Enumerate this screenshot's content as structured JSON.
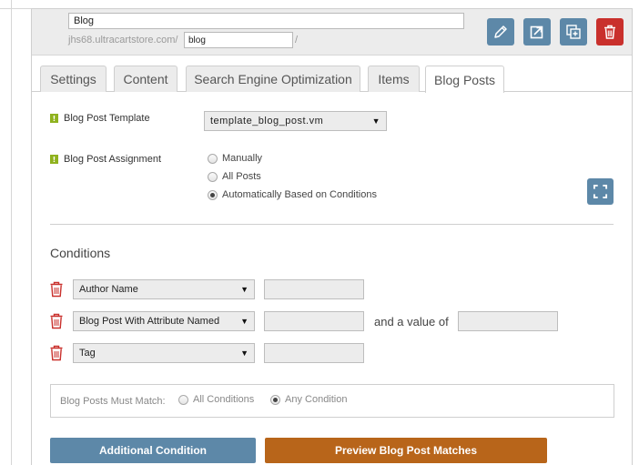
{
  "header": {
    "title_value": "Blog",
    "url_prefix": "jhs68.ultracartstore.com/",
    "slug_value": "blog",
    "url_suffix": "/",
    "buttons": [
      {
        "icon": "pencil-icon"
      },
      {
        "icon": "external-link-icon"
      },
      {
        "icon": "copy-icon"
      },
      {
        "icon": "trash-icon"
      }
    ],
    "colors": {
      "action_blue": "#5d88a8",
      "delete_red": "#c9302c"
    }
  },
  "tabs": [
    {
      "label": "Settings",
      "active": false
    },
    {
      "label": "Content",
      "active": false
    },
    {
      "label": "Search Engine Optimization",
      "active": false
    },
    {
      "label": "Items",
      "active": false
    },
    {
      "label": "Blog Posts",
      "active": true
    }
  ],
  "template": {
    "label": "Blog Post Template",
    "help_icon": "!",
    "selected": "template_blog_post.vm"
  },
  "assignment": {
    "label": "Blog Post Assignment",
    "help_icon": "!",
    "options": [
      {
        "label": "Manually",
        "checked": false
      },
      {
        "label": "All Posts",
        "checked": false
      },
      {
        "label": "Automatically Based on Conditions",
        "checked": true
      }
    ]
  },
  "conditions": {
    "title": "Conditions",
    "rows": [
      {
        "field": "Author Name",
        "value": ""
      },
      {
        "field": "Blog Post With Attribute Named",
        "value": "",
        "and_value_label": "and a value of",
        "extra_value": ""
      },
      {
        "field": "Tag",
        "value": ""
      }
    ]
  },
  "match": {
    "label": "Blog Posts Must Match:",
    "options": [
      {
        "label": "All Conditions",
        "checked": false
      },
      {
        "label": "Any Condition",
        "checked": true
      }
    ]
  },
  "actions": {
    "add_condition": "Additional Condition",
    "preview": "Preview Blog Post Matches",
    "colors": {
      "primary": "#5d88a8",
      "preview": "#b8651a"
    }
  }
}
